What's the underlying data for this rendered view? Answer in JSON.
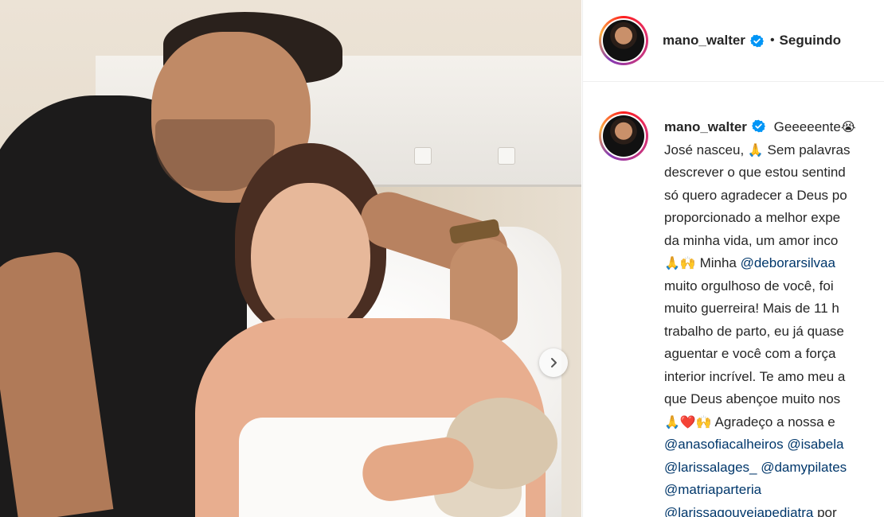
{
  "header": {
    "username": "mano_walter",
    "separator": "•",
    "follow_status": "Seguindo"
  },
  "caption": {
    "username": "mano_walter",
    "lines": [
      {
        "parts": [
          {
            "t": "Geeeeente"
          },
          {
            "t": "😭",
            "emoji": true
          }
        ]
      },
      {
        "parts": [
          {
            "t": "José nasceu, "
          },
          {
            "t": "🙏",
            "emoji": true
          },
          {
            "t": " Sem palavras"
          }
        ]
      },
      {
        "parts": [
          {
            "t": "descrever o que estou sentind"
          }
        ]
      },
      {
        "parts": [
          {
            "t": "só quero agradecer a Deus po"
          }
        ]
      },
      {
        "parts": [
          {
            "t": "proporcionado a melhor expe"
          }
        ]
      },
      {
        "parts": [
          {
            "t": "da minha vida, um amor inco"
          }
        ]
      },
      {
        "parts": [
          {
            "t": "🙏🙌",
            "emoji": true
          },
          {
            "t": " Minha "
          },
          {
            "t": "@deborarsilvaa",
            "mention": true
          }
        ]
      },
      {
        "parts": [
          {
            "t": "muito orgulhoso de você, foi"
          }
        ]
      },
      {
        "parts": [
          {
            "t": "muito guerreira! Mais de 11 h"
          }
        ]
      },
      {
        "parts": [
          {
            "t": "trabalho de parto, eu já quase"
          }
        ]
      },
      {
        "parts": [
          {
            "t": "aguentar e você com a força"
          }
        ]
      },
      {
        "parts": [
          {
            "t": "interior incrível. Te amo meu a"
          }
        ]
      },
      {
        "parts": [
          {
            "t": "que Deus abençoe muito nos"
          }
        ]
      },
      {
        "parts": [
          {
            "t": "🙏❤️🙌",
            "emoji": true
          },
          {
            "t": " Agradeço a nossa e"
          }
        ]
      },
      {
        "parts": [
          {
            "t": "@anasofiacalheiros",
            "mention": true
          },
          {
            "t": " "
          },
          {
            "t": "@isabela",
            "mention": true
          }
        ]
      },
      {
        "parts": [
          {
            "t": "@larissalages_",
            "mention": true
          },
          {
            "t": " "
          },
          {
            "t": "@damypilates",
            "mention": true
          }
        ]
      },
      {
        "parts": [
          {
            "t": "@matriaparteria",
            "mention": true
          }
        ]
      },
      {
        "parts": [
          {
            "t": "@larissagouveiapediatra",
            "mention": true
          },
          {
            "t": " por"
          }
        ]
      }
    ]
  },
  "icons": {
    "verified": "verified-badge-icon",
    "next": "chevron-right-icon"
  },
  "colors": {
    "text": "#262626",
    "mention": "#00376b",
    "verified": "#0095f6"
  }
}
